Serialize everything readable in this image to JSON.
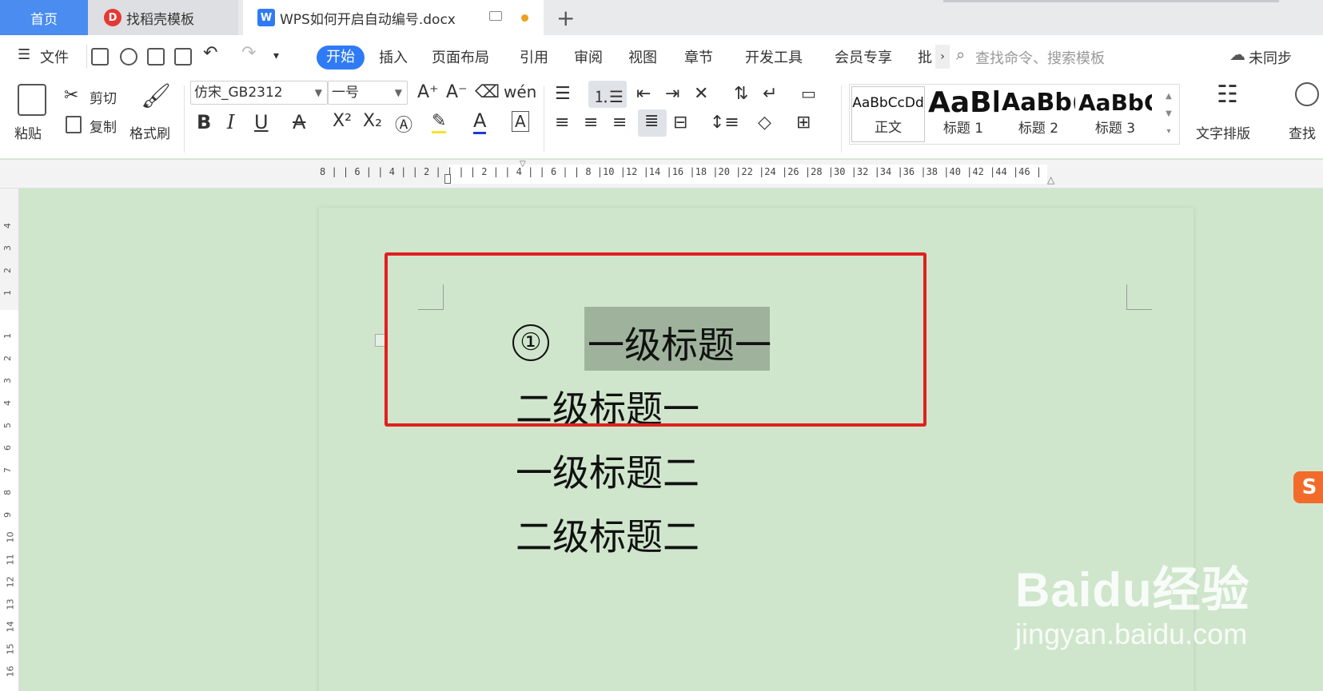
{
  "tabs": {
    "home": "首页",
    "daoke": "找稻壳模板",
    "document": "WPS如何开启自动编号.docx",
    "new_tab": "+"
  },
  "menu": {
    "file": "文件",
    "items": [
      "开始",
      "插入",
      "页面布局",
      "引用",
      "审阅",
      "视图",
      "章节",
      "开发工具",
      "会员专享",
      "批"
    ],
    "active": "开始",
    "search_placeholder": "查找命令、搜索模板",
    "sync": "未同步"
  },
  "ribbon": {
    "paste": "粘贴",
    "cut": "剪切",
    "copy": "复制",
    "format_painter": "格式刷",
    "font_name": "仿宋_GB2312",
    "font_size": "一号",
    "bold": "B",
    "italic": "I",
    "underline": "U",
    "font_color_letter": "A",
    "styles": [
      {
        "sample": "AaBbCcDd",
        "name": "正文"
      },
      {
        "sample": "AaBb",
        "name": "标题 1"
      },
      {
        "sample": "AaBb(",
        "name": "标题 2"
      },
      {
        "sample": "AaBbC",
        "name": "标题 3"
      }
    ],
    "text_layout": "文字排版",
    "find": "查找"
  },
  "ruler": {
    "ticks": "8 | | 6 | | 4 | | 2 | |   | | 2 | | 4 | | 6 | | 8 |10 |12 |14 |16 |18 |20 |22 |24 |26 |28 |30 |32 |34 |36 |38 |40 |42 |44 |46 |"
  },
  "document": {
    "list_number": "①",
    "paragraphs": [
      "一级标题一",
      "二级标题一",
      "一级标题二",
      "二级标题二"
    ]
  },
  "overlays": {
    "sogou": "S",
    "watermark_line1": "Baidu经验",
    "watermark_line2": "jingyan.baidu.com"
  },
  "colors": {
    "accent": "#2f7bf5",
    "highlight_box": "#e02020",
    "page_bg": "#cfe6cc",
    "selection": "#9fb39c"
  }
}
